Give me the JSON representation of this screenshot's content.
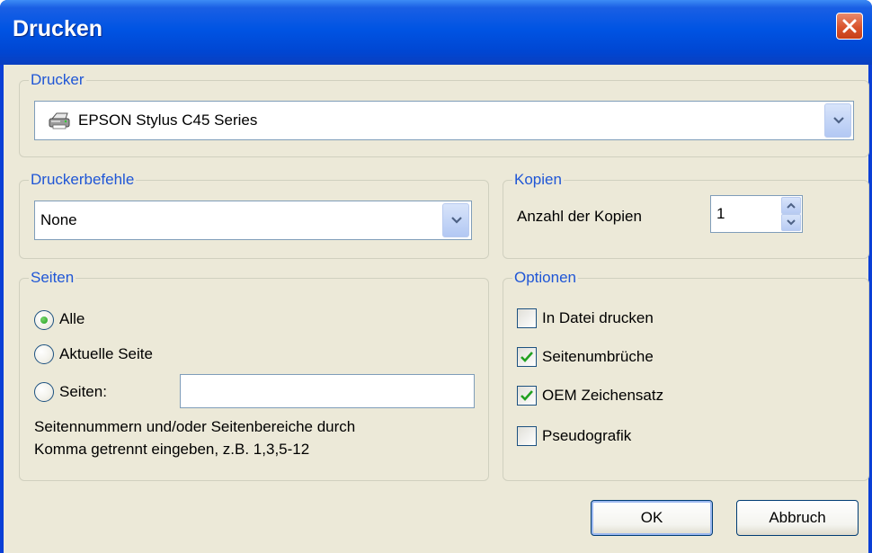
{
  "window": {
    "title": "Drucken"
  },
  "printer_group": {
    "legend": "Drucker",
    "selected": "EPSON Stylus C45 Series",
    "icon": "printer-icon"
  },
  "commands_group": {
    "legend": "Druckerbefehle",
    "selected": "None"
  },
  "copies_group": {
    "legend": "Kopien",
    "label": "Anzahl der Kopien",
    "value": "1"
  },
  "pages_group": {
    "legend": "Seiten",
    "options": [
      {
        "label": "Alle",
        "checked": true
      },
      {
        "label": "Aktuelle Seite",
        "checked": false
      },
      {
        "label": "Seiten:",
        "checked": false
      }
    ],
    "range_value": "",
    "hint_line1": "Seitennummern und/oder Seitenbereiche durch",
    "hint_line2": "Komma getrennt eingeben, z.B. 1,3,5-12"
  },
  "options_group": {
    "legend": "Optionen",
    "items": [
      {
        "label": "In Datei drucken",
        "checked": false
      },
      {
        "label": "Seitenumbrüche",
        "checked": true
      },
      {
        "label": "OEM Zeichensatz",
        "checked": true
      },
      {
        "label": "Pseudografik",
        "checked": false
      }
    ]
  },
  "buttons": {
    "ok": "OK",
    "cancel": "Abbruch"
  },
  "colors": {
    "title_bar": "#0054e3",
    "legend_text": "#1f56d6",
    "client_bg": "#ece9d8",
    "close_button": "#d9532c"
  }
}
